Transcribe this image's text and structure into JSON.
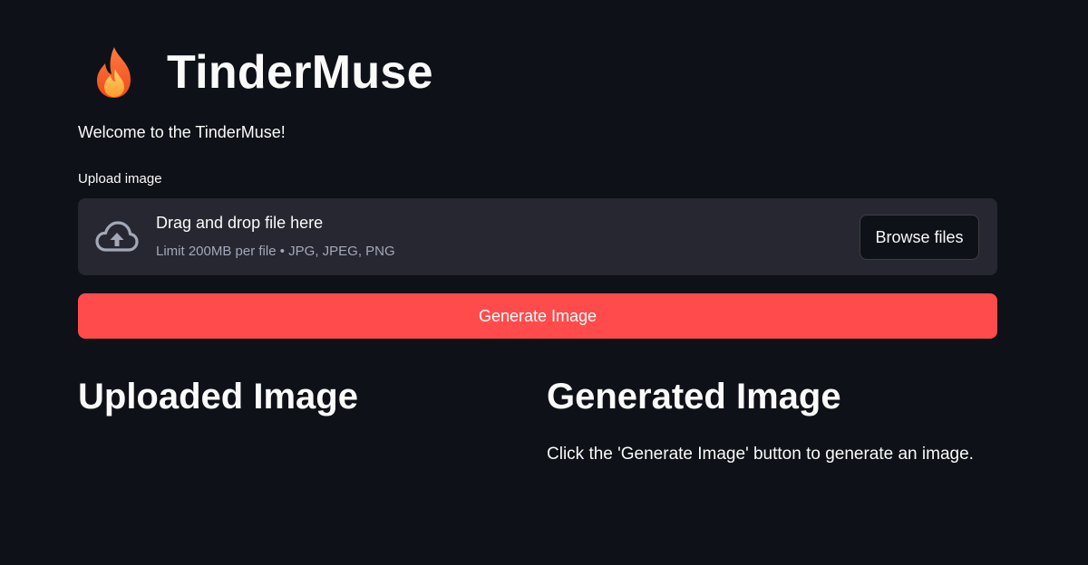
{
  "header": {
    "icon": "fire-icon",
    "title": "TinderMuse"
  },
  "welcome_text": "Welcome to the TinderMuse!",
  "uploader": {
    "label": "Upload image",
    "icon": "cloud-upload-icon",
    "drag_text": "Drag and drop file here",
    "limit_text": "Limit 200MB per file • JPG, JPEG, PNG",
    "browse_label": "Browse files"
  },
  "actions": {
    "generate_label": "Generate Image"
  },
  "columns": {
    "uploaded_heading": "Uploaded Image",
    "generated_heading": "Generated Image",
    "generated_placeholder": "Click the 'Generate Image' button to generate an image."
  },
  "colors": {
    "background": "#0e1117",
    "surface": "#262730",
    "primary": "#ff4b4b",
    "text": "#fafafa",
    "muted": "#a3a8b8"
  }
}
